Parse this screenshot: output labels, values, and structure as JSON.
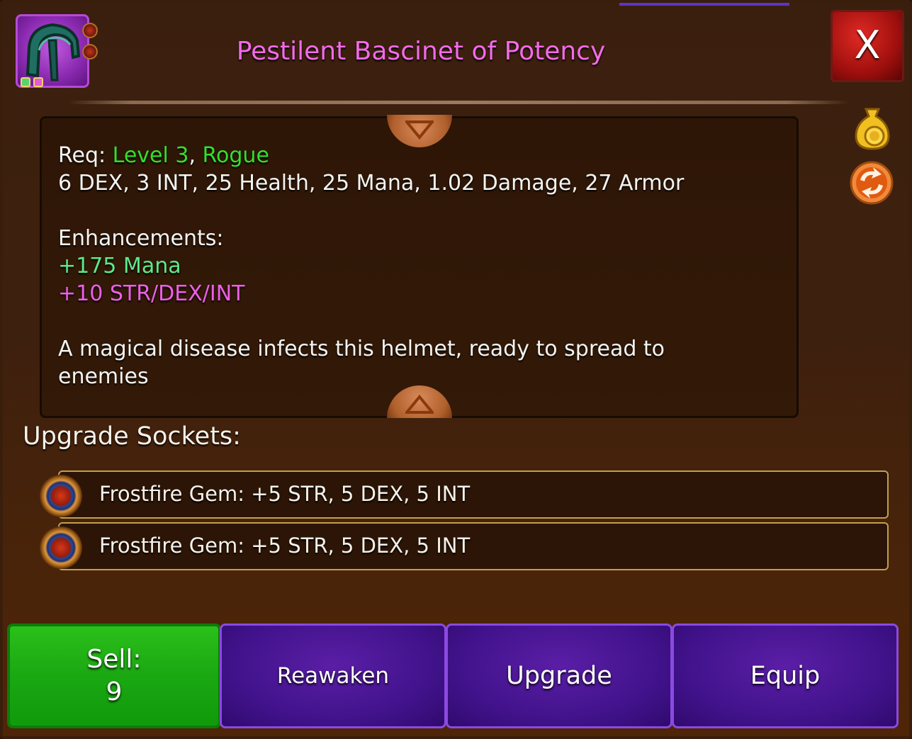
{
  "item": {
    "title": "Pestilent Bascinet of Potency",
    "icon": "helmet-icon",
    "title_color": "#f26be8"
  },
  "close": {
    "label": "X"
  },
  "description": {
    "req_prefix": "Req: ",
    "req_level": "Level 3",
    "req_sep": ", ",
    "req_class": "Rogue",
    "stats": "6 DEX, 3 INT, 25 Health, 25 Mana, 1.02 Damage, 27 Armor",
    "enhancements_header": "Enhancements:",
    "enhancement_1": "+175 Mana",
    "enhancement_2": "+10 STR/DEX/INT",
    "flavor_line_1": "A magical disease infects this helmet, ready to spread to",
    "flavor_line_2": "enemies"
  },
  "side_icons": [
    "gold-bag-icon",
    "swap-arrows-icon"
  ],
  "sockets": {
    "title": "Upgrade Sockets:",
    "items": [
      {
        "label": "Frostfire Gem: +5 STR, 5 DEX, 5 INT",
        "icon": "gem-icon"
      },
      {
        "label": "Frostfire Gem: +5 STR, 5 DEX, 5 INT",
        "icon": "gem-icon"
      }
    ]
  },
  "actions": {
    "sell_label": "Sell:",
    "sell_price": "9",
    "reawaken_label": "Reawaken",
    "upgrade_label": "Upgrade",
    "equip_label": "Equip"
  },
  "colors": {
    "green_text": "#33e02c",
    "mint_text": "#5ee888",
    "magenta_text": "#ee5ee8",
    "sell_button": "#1aa812",
    "purple_button": "#40128a",
    "close_button": "#a0100e"
  }
}
